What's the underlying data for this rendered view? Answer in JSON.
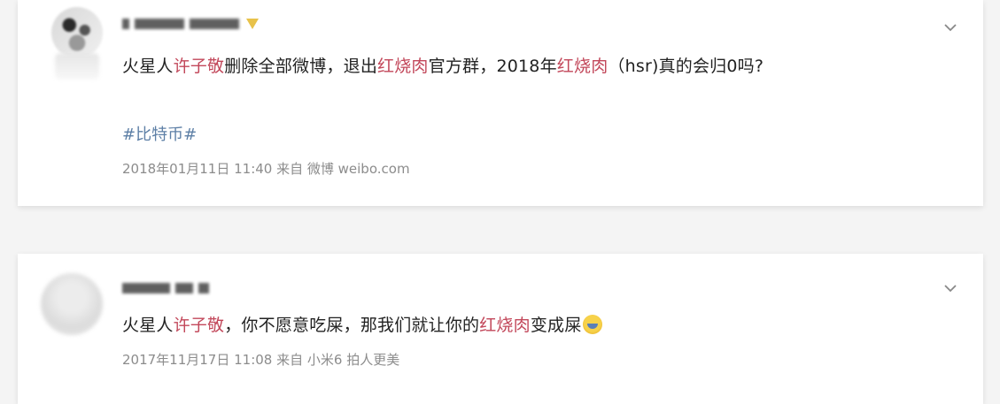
{
  "posts": [
    {
      "text_segments": [
        {
          "t": "火星人",
          "hl": false
        },
        {
          "t": "许子敬",
          "hl": true
        },
        {
          "t": "删除全部微博，退出",
          "hl": false
        },
        {
          "t": "红烧肉",
          "hl": true
        },
        {
          "t": "官方群，2018年",
          "hl": false
        },
        {
          "t": "红烧肉",
          "hl": true
        },
        {
          "t": "（hsr)真的会归0吗?",
          "hl": false
        }
      ],
      "topic": "#比特币#",
      "meta": "2018年01月11日 11:40  来自 微博 weibo.com"
    },
    {
      "text_segments": [
        {
          "t": "火星人",
          "hl": false
        },
        {
          "t": "许子敬",
          "hl": true
        },
        {
          "t": "，你不愿意吃屎，那我们就让你的",
          "hl": false
        },
        {
          "t": "红烧肉",
          "hl": true
        },
        {
          "t": "变成屎",
          "hl": false
        }
      ],
      "meta": "2017年11月17日 11:08  来自 小米6 拍人更美"
    }
  ],
  "icons": {
    "expand": "chevron-down-icon",
    "emoji": "laugh-cry-emoji-icon"
  },
  "colors": {
    "highlight": "#c2475a",
    "topic": "#5d7fa6",
    "meta": "#8c8c8c",
    "text": "#222222"
  }
}
